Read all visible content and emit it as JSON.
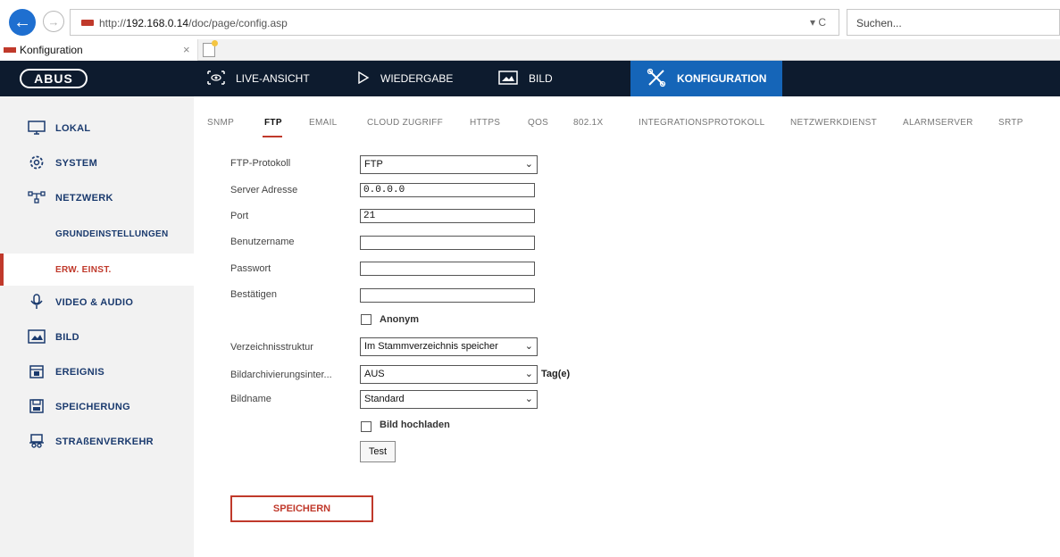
{
  "browser": {
    "url_prefix": "http://",
    "url_host": "192.168.0.14",
    "url_path": "/doc/page/config.asp",
    "url_actions": "▾ C",
    "search_placeholder": "Suchen...",
    "tab_label": "Konfiguration",
    "tab_close": "×"
  },
  "topnav": {
    "logo": "ABUS",
    "items": [
      {
        "label": "LIVE-ANSICHT",
        "icon": "eye-icon"
      },
      {
        "label": "WIEDERGABE",
        "icon": "play-icon"
      },
      {
        "label": "BILD",
        "icon": "image-icon"
      },
      {
        "label": "KONFIGURATION",
        "icon": "tools-icon",
        "active": true
      }
    ]
  },
  "sidebar": {
    "items": [
      {
        "label": "LOKAL",
        "icon": "monitor-icon"
      },
      {
        "label": "SYSTEM",
        "icon": "gear-icon"
      },
      {
        "label": "NETZWERK",
        "icon": "network-icon"
      },
      {
        "label": "GRUNDEINSTELLUNGEN",
        "sub": true
      },
      {
        "label": "ERW. EINST.",
        "sub": true,
        "active": true
      },
      {
        "label": "VIDEO & AUDIO",
        "icon": "microphone-icon"
      },
      {
        "label": "BILD",
        "icon": "image-icon"
      },
      {
        "label": "EREIGNIS",
        "icon": "calendar-icon"
      },
      {
        "label": "SPEICHERUNG",
        "icon": "storage-icon"
      },
      {
        "label": "STRAßENVERKEHR",
        "icon": "car-icon"
      }
    ]
  },
  "subtabs": [
    "SNMP",
    "FTP",
    "EMAIL",
    "CLOUD ZUGRIFF",
    "HTTPS",
    "QOS",
    "802.1X",
    "INTEGRATIONSPROTOKOLL",
    "NETZWERKDIENST",
    "ALARMSERVER",
    "SRTP"
  ],
  "active_subtab": "FTP",
  "form": {
    "protocol_label": "FTP-Protokoll",
    "protocol_value": "FTP",
    "server_label": "Server Adresse",
    "server_value": "0.0.0.0",
    "port_label": "Port",
    "port_value": "21",
    "user_label": "Benutzername",
    "user_value": "",
    "password_label": "Passwort",
    "password_value": "",
    "confirm_label": "Bestätigen",
    "confirm_value": "",
    "anonymous_label": "Anonym",
    "anonymous_checked": false,
    "dir_label": "Verzeichnisstruktur",
    "dir_value": "Im Stammverzeichnis speicher",
    "archive_label": "Bildarchivierungsinter...",
    "archive_value": "AUS",
    "archive_unit": "Tag(e)",
    "imagename_label": "Bildname",
    "imagename_value": "Standard",
    "upload_label": "Bild hochladen",
    "upload_checked": false,
    "test_button": "Test",
    "save_button": "SPEICHERN"
  }
}
